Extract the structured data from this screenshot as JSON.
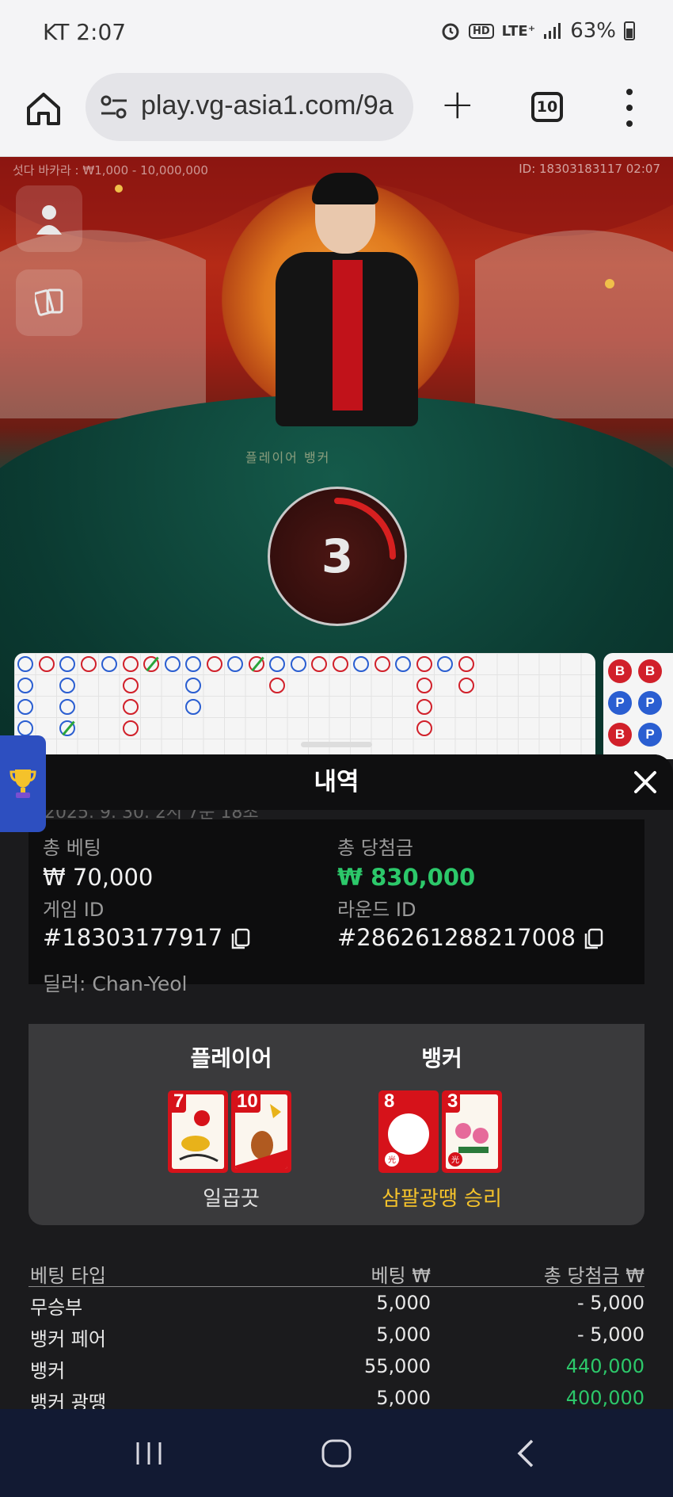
{
  "status_bar": {
    "time": "KT 2:07",
    "network": "LTE⁺",
    "battery": "63%"
  },
  "browser": {
    "url": "play.vg-asia1.com/9a",
    "tab_count": "10"
  },
  "game": {
    "table_info": "섯다 바카라 : ₩1,000 - 10,000,000",
    "game_id_info": "ID: 18303183117 02:07",
    "table_labels": "플레이어      뱅커",
    "countdown": "3",
    "road_colors": {
      "banker": "#d1202a",
      "player": "#2a5ed1"
    }
  },
  "history": {
    "title": "내역",
    "datetime": "2025. 9. 30. 2시 7분 18초",
    "total_bet_label": "총 베팅",
    "total_bet_value": "₩ 70,000",
    "total_win_label": "총 당첨금",
    "total_win_value": "₩ 830,000",
    "game_id_label": "게임 ID",
    "game_id_value": "#18303177917",
    "round_id_label": "라운드 ID",
    "round_id_value": "#286261288217008",
    "dealer": "딜러: Chan-Yeol",
    "player_title": "플레이어",
    "banker_title": "뱅커",
    "player_cards": [
      "7",
      "10"
    ],
    "banker_cards": [
      "8",
      "3"
    ],
    "player_result": "일곱끗",
    "banker_result": "삼팔광땡 승리",
    "table_headers": [
      "베팅 타입",
      "베팅 ₩",
      "총 당첨금 ₩"
    ],
    "bets": [
      {
        "type": "무승부",
        "bet": "5,000",
        "win": "- 5,000"
      },
      {
        "type": "뱅커 페어",
        "bet": "5,000",
        "win": "- 5,000"
      },
      {
        "type": "뱅커",
        "bet": "55,000",
        "win": "440,000"
      },
      {
        "type": "뱅커 광땡",
        "bet": "5,000",
        "win": "400,000"
      }
    ]
  },
  "bead_labels": {
    "banker": "B",
    "player": "P"
  }
}
